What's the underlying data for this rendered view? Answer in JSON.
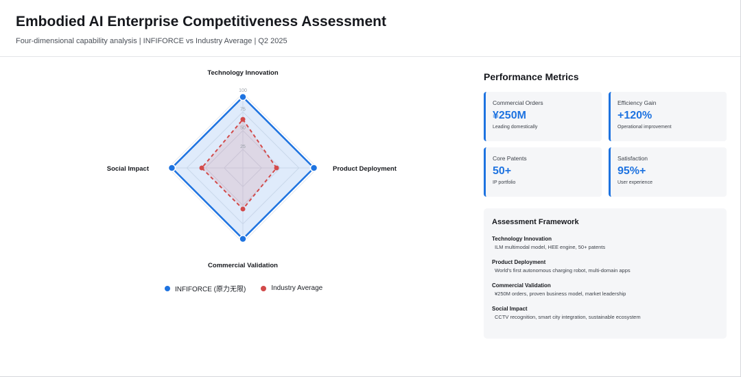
{
  "header": {
    "title": "Embodied AI Enterprise Competitiveness Assessment",
    "subtitle": "Four-dimensional capability analysis | INFIFORCE vs Industry Average | Q2 2025"
  },
  "chart_data": {
    "type": "radar",
    "axes": [
      "Technology Innovation",
      "Product Deployment",
      "Commercial Validation",
      "Social Impact"
    ],
    "ticks": [
      "25",
      "50",
      "75",
      "100"
    ],
    "range": [
      0,
      100
    ],
    "series": [
      {
        "name": "INFIFORCE (原力无限)",
        "values": [
          95,
          95,
          95,
          95
        ],
        "color": "#1e73e0"
      },
      {
        "name": "Industry Average",
        "values": [
          65,
          45,
          55,
          55
        ],
        "color": "#d24a4a"
      }
    ]
  },
  "metrics": {
    "title": "Performance Metrics",
    "cards": [
      {
        "label": "Commercial Orders",
        "value": "¥250M",
        "sub": "Leading domestically"
      },
      {
        "label": "Efficiency Gain",
        "value": "+120%",
        "sub": "Operational improvement"
      },
      {
        "label": "Core Patents",
        "value": "50+",
        "sub": "IP portfolio"
      },
      {
        "label": "Satisfaction",
        "value": "95%+",
        "sub": "User experience"
      }
    ]
  },
  "framework": {
    "title": "Assessment Framework",
    "items": [
      {
        "name": "Technology Innovation",
        "desc": "ILM multimodal model, HEE engine, 50+ patents"
      },
      {
        "name": "Product Deployment",
        "desc": "World's first autonomous charging robot, multi-domain apps"
      },
      {
        "name": "Commercial Validation",
        "desc": "¥250M orders, proven business model, market leadership"
      },
      {
        "name": "Social Impact",
        "desc": "CCTV recognition, smart city integration, sustainable ecosystem"
      }
    ]
  }
}
